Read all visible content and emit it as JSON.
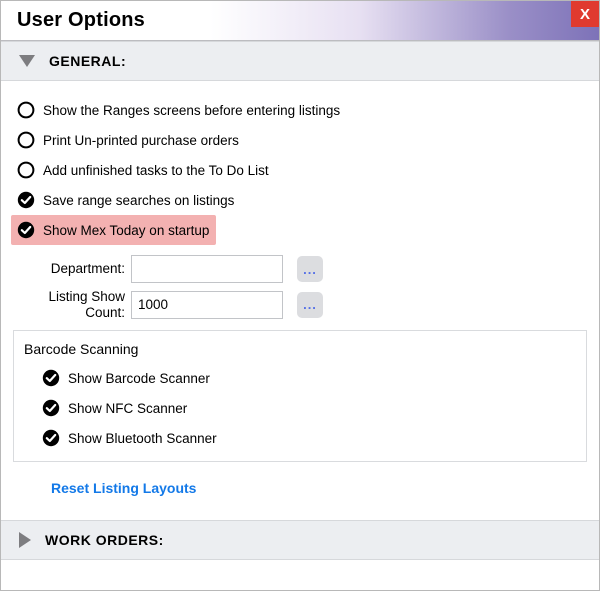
{
  "window": {
    "title": "User Options",
    "close_label": "X"
  },
  "sections": {
    "general": {
      "label": "GENERAL:",
      "options": {
        "ranges": {
          "label": "Show the Ranges screens before entering listings",
          "checked": false
        },
        "print_unprinted": {
          "label": "Print Un-printed purchase orders",
          "checked": false
        },
        "unfinished_tasks": {
          "label": "Add unfinished tasks to the To Do List",
          "checked": false
        },
        "save_range": {
          "label": "Save range searches on listings",
          "checked": true
        },
        "mex_today": {
          "label": "Show Mex Today on startup",
          "checked": true
        }
      },
      "fields": {
        "department": {
          "label": "Department:",
          "value": "",
          "picker": "..."
        },
        "listing_show_count": {
          "label": "Listing Show Count:",
          "value": "1000",
          "picker": "..."
        }
      },
      "barcode_group": {
        "title": "Barcode Scanning",
        "options": {
          "barcode": {
            "label": "Show Barcode Scanner",
            "checked": true
          },
          "nfc": {
            "label": "Show NFC Scanner",
            "checked": true
          },
          "bluetooth": {
            "label": "Show Bluetooth Scanner",
            "checked": true
          }
        }
      },
      "reset_link": "Reset Listing Layouts"
    },
    "work_orders": {
      "label": "WORK ORDERS:"
    }
  }
}
